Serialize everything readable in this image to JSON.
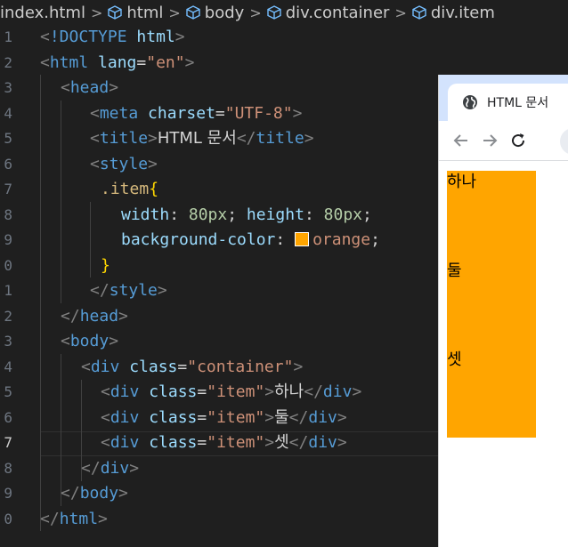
{
  "breadcrumb": {
    "file": "index.html",
    "items": [
      "html",
      "body",
      "div.container",
      "div.item"
    ]
  },
  "editor": {
    "line_numbers": [
      "1",
      "2",
      "3",
      "4",
      "5",
      "6",
      "7",
      "8",
      "9",
      "0",
      "1",
      "2",
      "3",
      "4",
      "5",
      "6",
      "7",
      "8",
      "9",
      "0"
    ],
    "active_line_index": 16,
    "code": {
      "doctype": "!DOCTYPE",
      "html_tag": "html",
      "lang_attr": "lang",
      "lang_val": "\"en\"",
      "head": "head",
      "meta": "meta",
      "charset_attr": "charset",
      "charset_val": "\"UTF-8\"",
      "title": "title",
      "title_text": "HTML 문서",
      "style": "style",
      "selector": ".item",
      "open_brace": "{",
      "close_brace": "}",
      "width_prop": "width",
      "width_val": "80px",
      "height_prop": "height",
      "height_val": "80px",
      "bg_prop": "background-color",
      "bg_val": "orange",
      "body": "body",
      "div": "div",
      "class_attr": "class",
      "container_val": "\"container\"",
      "item_val": "\"item\"",
      "text1": "하나",
      "text2": "둘",
      "text3": "셋"
    },
    "swatch_color": "#ffa500"
  },
  "browser": {
    "tab_title": "HTML 문서",
    "items": [
      "하나",
      "둘",
      "셋"
    ],
    "item_color": "#ffa500"
  }
}
